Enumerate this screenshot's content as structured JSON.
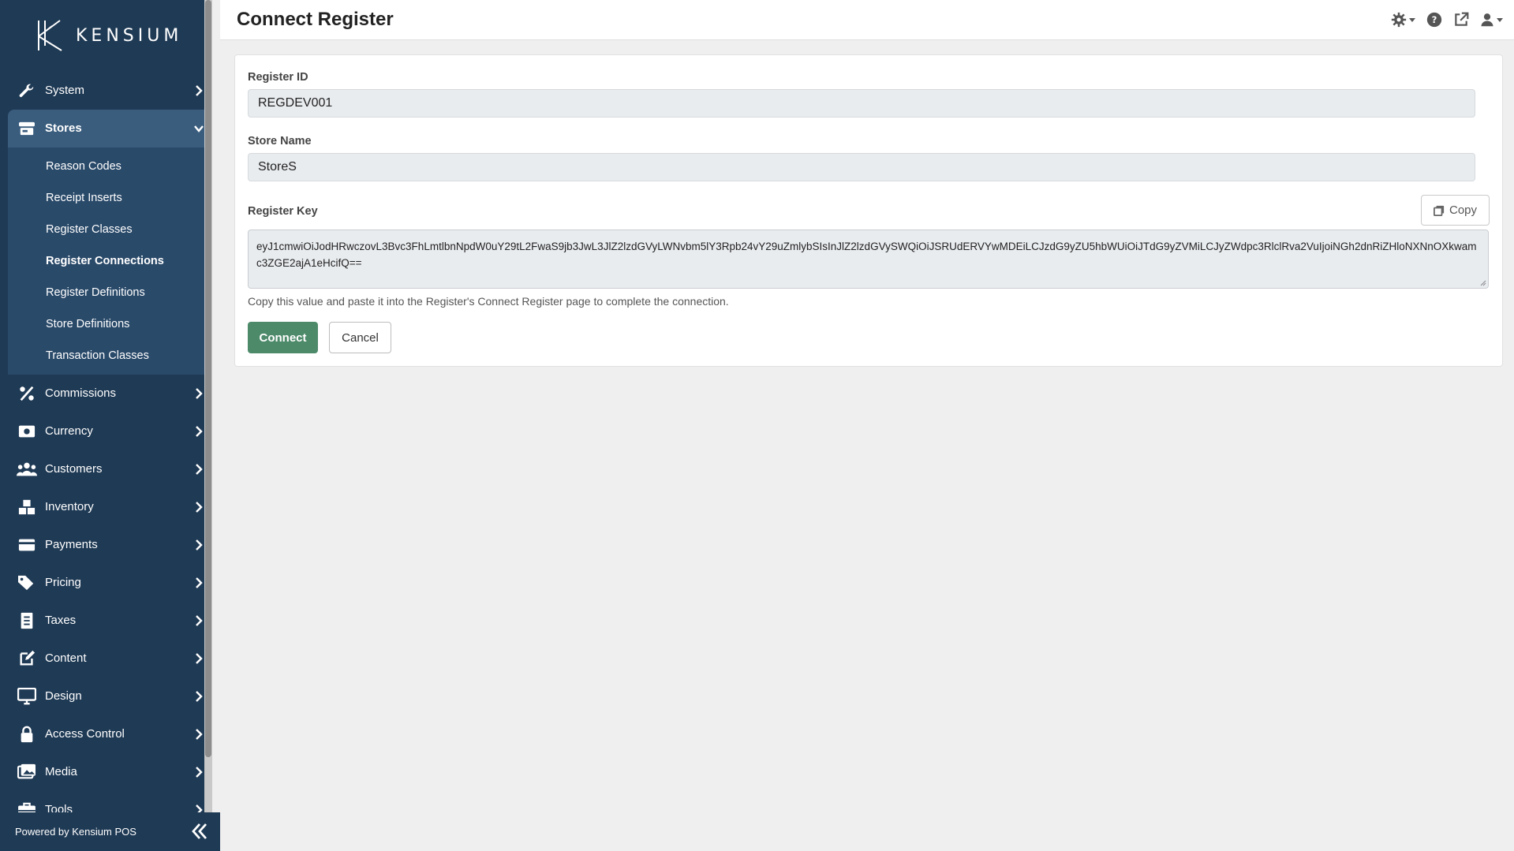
{
  "brand": {
    "name": "KENSIUM"
  },
  "sidebar": {
    "items": [
      {
        "label": "System",
        "icon": "wrench-icon"
      },
      {
        "label": "Stores",
        "icon": "store-icon",
        "expanded": true,
        "children": [
          {
            "label": "Reason Codes"
          },
          {
            "label": "Receipt Inserts"
          },
          {
            "label": "Register Classes"
          },
          {
            "label": "Register Connections",
            "selected": true
          },
          {
            "label": "Register Definitions"
          },
          {
            "label": "Store Definitions"
          },
          {
            "label": "Transaction Classes"
          }
        ]
      },
      {
        "label": "Commissions",
        "icon": "percent-icon"
      },
      {
        "label": "Currency",
        "icon": "money-bill-icon"
      },
      {
        "label": "Customers",
        "icon": "users-icon"
      },
      {
        "label": "Inventory",
        "icon": "boxes-icon"
      },
      {
        "label": "Payments",
        "icon": "credit-card-icon"
      },
      {
        "label": "Pricing",
        "icon": "tags-icon"
      },
      {
        "label": "Taxes",
        "icon": "receipt-icon"
      },
      {
        "label": "Content",
        "icon": "edit-icon"
      },
      {
        "label": "Design",
        "icon": "desktop-icon"
      },
      {
        "label": "Access Control",
        "icon": "lock-icon"
      },
      {
        "label": "Media",
        "icon": "images-icon"
      },
      {
        "label": "Tools",
        "icon": "toolbox-icon"
      }
    ],
    "footer": "Powered by Kensium POS"
  },
  "header": {
    "title": "Connect Register",
    "tools": [
      "settings-icon",
      "help-icon",
      "external-link-icon",
      "user-icon"
    ]
  },
  "form": {
    "register_id": {
      "label": "Register ID",
      "value": "REGDEV001"
    },
    "store_name": {
      "label": "Store Name",
      "value": "StoreS"
    },
    "register_key": {
      "label": "Register Key",
      "value": "eyJ1cmwiOiJodHRwczovL3Bvc3FhLmtlbnNpdW0uY29tL2FwaS9jb3JwL3JlZ2lzdGVyLWNvbm5lY3Rpb24vY29uZmlybSIsInJlZ2lzdGVySWQiOiJSRUdERVYwMDEiLCJzdG9yZU5hbWUiOiJTdG9yZVMiLCJyZWdpc3RlclRva2VuIjoiNGh2dnRiZHloNXNnOXkwamc3ZGE2ajA1eHcifQ==",
      "copy_label": "Copy"
    },
    "hint": "Copy this value and paste it into the Register's Connect Register page to complete the connection.",
    "connect_label": "Connect",
    "cancel_label": "Cancel"
  },
  "colors": {
    "sidebar_bg": "#1f3a55",
    "sidebar_active": "#3a5d7e",
    "submenu_bg": "#2a4a6a",
    "primary_button": "#4d8a6a"
  }
}
